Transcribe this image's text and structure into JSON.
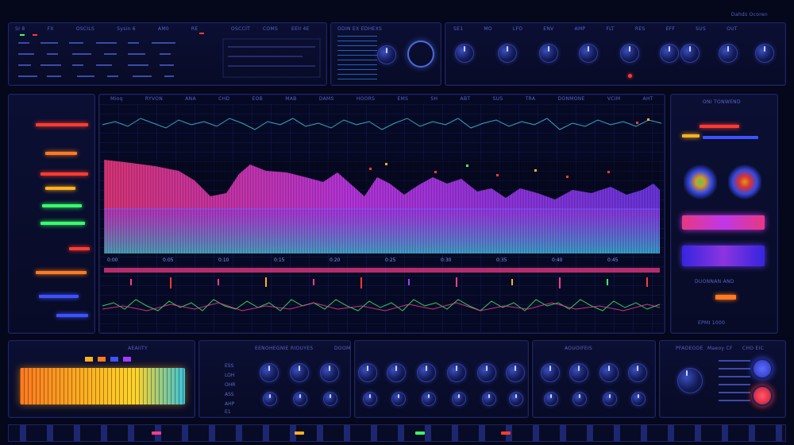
{
  "top": {
    "left_header": [
      "SI 8",
      "FX",
      "OSCILS",
      "Sysin 6",
      "AM0",
      "RE"
    ],
    "mid_header": [
      "OSCCIT",
      "COMS",
      "EEII 4E"
    ],
    "osc_title": "ODIN EX EDHEXS",
    "knob_bank_header": [
      "SE1",
      "MO",
      "LFO",
      "ENV",
      "AMP",
      "FLT",
      "RES",
      "EFF",
      "SUS",
      "OUT"
    ],
    "right_header": "Dahds Ocoren"
  },
  "display": {
    "ruler": [
      "Mioq",
      "RYVON",
      "ANA",
      "CHD",
      "EOB",
      "MAB",
      "DAMS",
      "HOORS",
      "EMS",
      "SH",
      "ABT",
      "SUS",
      "TRA",
      "DONMONE",
      "VCIM",
      "AHT"
    ],
    "timecodes": [
      "0:00",
      "0:05",
      "0:10",
      "0:15",
      "0:20",
      "0:25",
      "0:30",
      "0:35",
      "0:40",
      "0:45"
    ]
  },
  "right_panel": {
    "header": "ONI TONWEND",
    "sublabel": "DUONNAN AND",
    "bottom_label": "EPMI 1000"
  },
  "bottom": {
    "eq_title": "AEAIITY",
    "mid_title": "EENOHEGNIE RIOUYES",
    "mid_title2": "DOOM",
    "right_title": "AOUOIFEIS",
    "far_right": [
      "PFAOEOOE",
      "Maeoy CF",
      "CHO EIC"
    ],
    "row_labels": [
      "ESS",
      "LOH",
      "OHR",
      "ASS",
      "AHP",
      "E1"
    ]
  },
  "colors": {
    "accent": "#3d52ff",
    "spectrum_pink": "#ff3d8a",
    "spectrum_purple": "#a33cff",
    "spectrum_cyan": "#39c4d9",
    "led_red": "#ff3b30",
    "led_green": "#39ff6a",
    "led_amber": "#ffb020"
  }
}
